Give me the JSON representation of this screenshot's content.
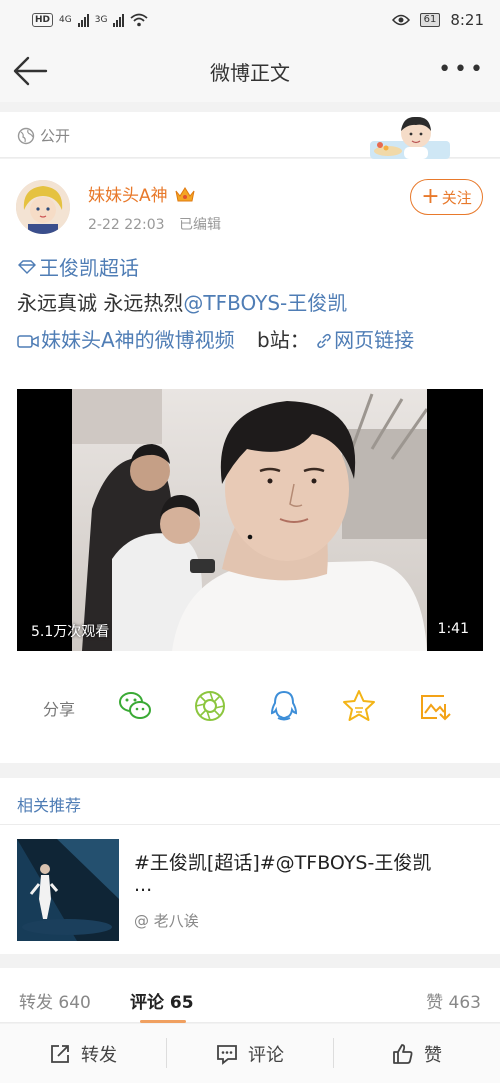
{
  "status_bar": {
    "network_badge": "HD",
    "signal_1": "4G",
    "signal_2": "3G",
    "battery": "61",
    "time": "8:21"
  },
  "nav": {
    "title": "微博正文",
    "more": "•••"
  },
  "visibility": {
    "label": "公开"
  },
  "post": {
    "username": "妹妹头A神",
    "timestamp": "2-22 22:03",
    "edited": "已编辑",
    "follow_label": "关注",
    "topic": "王俊凯超话",
    "text_prefix": "永远真诚 永远热烈",
    "mention": "@TFBOYS-王俊凯",
    "video_link": "妹妹头A神的微博视频",
    "b_label": "b站：",
    "web_link": "网页链接",
    "video": {
      "views": "5.1万次观看",
      "duration": "1:41"
    },
    "share_label": "分享"
  },
  "related": {
    "title": "相关推荐",
    "item": {
      "text": "#王俊凯[超话]#@TFBOYS-王俊凯",
      "ellipsis": "...",
      "author": "@ 老八诶"
    }
  },
  "stats": {
    "repost": "转发 640",
    "comments": "评论 65",
    "likes": "赞 463"
  },
  "toolbar": {
    "repost": "转发",
    "comment": "评论",
    "like": "赞"
  },
  "colors": {
    "accent_orange": "#e8792b",
    "link_blue": "#4f7db5",
    "wechat_green": "#3aaa35",
    "moments_green": "#8cc63f",
    "qq_blue": "#3d8ed8",
    "favorite_yellow": "#f3b416"
  }
}
